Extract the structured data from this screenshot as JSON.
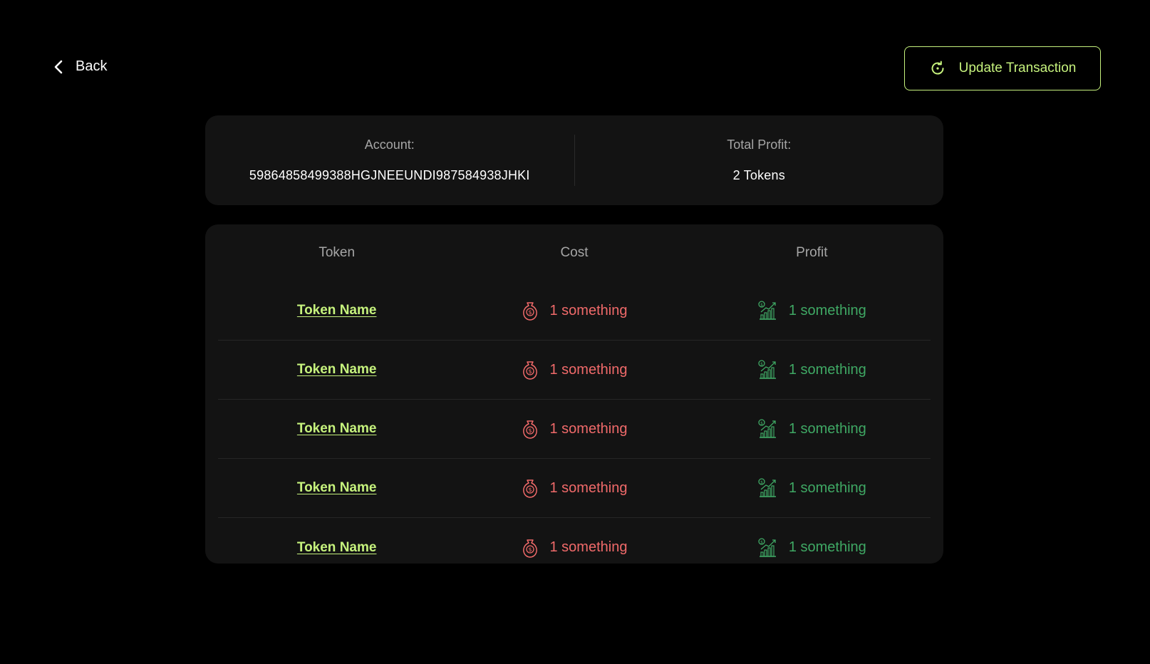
{
  "header": {
    "back_label": "Back",
    "update_label": "Update Transaction"
  },
  "summary": {
    "account_label": "Account:",
    "account_value": "59864858499388HGJNEEUNDI987584938JHKI",
    "profit_label": "Total Profit:",
    "profit_value": "2 Tokens"
  },
  "table": {
    "columns": [
      "Token",
      "Cost",
      "Profit"
    ],
    "rows": [
      {
        "token": "Token Name",
        "cost": "1 something",
        "profit": "1 something"
      },
      {
        "token": "Token Name",
        "cost": "1 something",
        "profit": "1 something"
      },
      {
        "token": "Token Name",
        "cost": "1 something",
        "profit": "1 something"
      },
      {
        "token": "Token Name",
        "cost": "1 something",
        "profit": "1 something"
      },
      {
        "token": "Token Name",
        "cost": "1 something",
        "profit": "1 something"
      }
    ]
  },
  "colors": {
    "accent": "#c6f27d",
    "cost": "#f06a6a",
    "profit": "#3fa864",
    "card_bg": "#131313",
    "page_bg": "#000000"
  },
  "icons": {
    "back": "chevron-left-icon",
    "update": "refresh-icon",
    "cost": "money-bag-icon",
    "profit": "growth-chart-icon"
  }
}
